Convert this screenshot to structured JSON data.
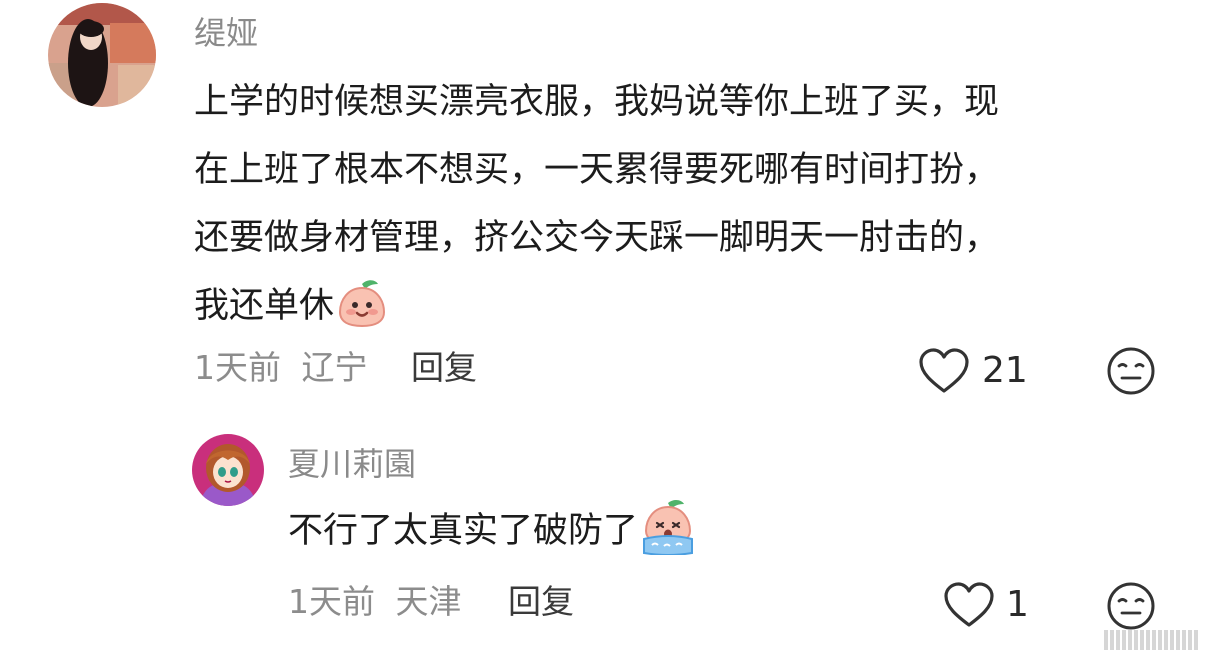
{
  "comments": [
    {
      "username": "缇娅",
      "lines": [
        "上学的时候想买漂亮衣服，我妈说等你上班了买，现",
        "在上班了根本不想买，一天累得要死哪有时间打扮，",
        "还要做身材管理，挤公交今天踩一脚明天一肘击的，",
        "我还单休"
      ],
      "emoji": "peach-smile-emoji",
      "time": "1天前",
      "location": "辽宁",
      "reply_label": "回复",
      "like_count": "21"
    },
    {
      "username": "夏川莉園",
      "lines": [
        "不行了太真实了破防了"
      ],
      "emoji": "peach-crying-emoji",
      "time": "1天前",
      "location": "天津",
      "reply_label": "回复",
      "like_count": "1"
    }
  ],
  "icons": {
    "like": "heart-outline-icon",
    "dislike": "expressionless-face-icon"
  },
  "colors": {
    "username": "#8a8a8a",
    "meta": "#8c8c8c",
    "text": "#1c1c1c",
    "peach": "#f6b3a6",
    "leaf": "#4fb36a"
  }
}
